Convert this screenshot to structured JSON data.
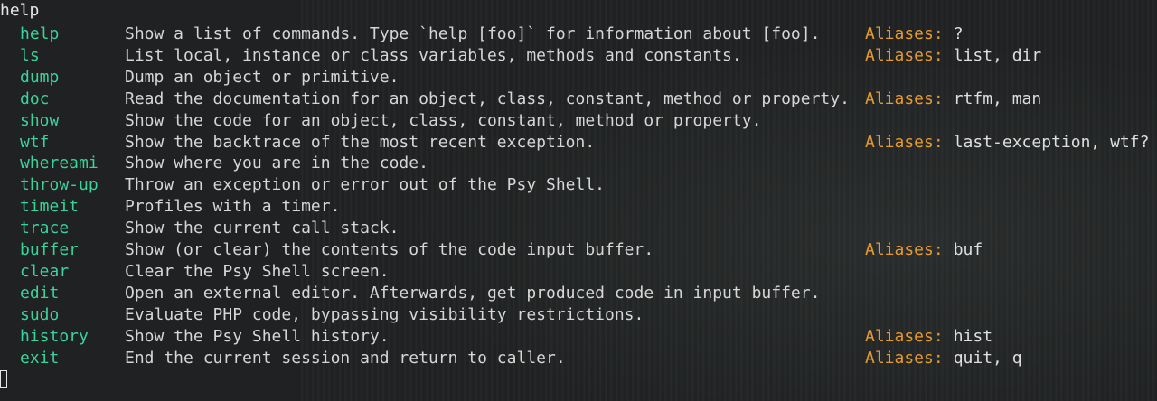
{
  "terminal": {
    "input_command": "help",
    "aliases_label": "Aliases:",
    "commands": [
      {
        "name": "help",
        "description": "Show a list of commands. Type `help [foo]` for information about [foo].",
        "aliases": "?"
      },
      {
        "name": "ls",
        "description": "List local, instance or class variables, methods and constants.",
        "aliases": "list, dir"
      },
      {
        "name": "dump",
        "description": "Dump an object or primitive.",
        "aliases": ""
      },
      {
        "name": "doc",
        "description": "Read the documentation for an object, class, constant, method or property.",
        "aliases": "rtfm, man"
      },
      {
        "name": "show",
        "description": "Show the code for an object, class, constant, method or property.",
        "aliases": ""
      },
      {
        "name": "wtf",
        "description": "Show the backtrace of the most recent exception.",
        "aliases": "last-exception, wtf?"
      },
      {
        "name": "whereami",
        "description": "Show where you are in the code.",
        "aliases": ""
      },
      {
        "name": "throw-up",
        "description": "Throw an exception or error out of the Psy Shell.",
        "aliases": ""
      },
      {
        "name": "timeit",
        "description": "Profiles with a timer.",
        "aliases": ""
      },
      {
        "name": "trace",
        "description": "Show the current call stack.",
        "aliases": ""
      },
      {
        "name": "buffer",
        "description": "Show (or clear) the contents of the code input buffer.",
        "aliases": "buf"
      },
      {
        "name": "clear",
        "description": "Clear the Psy Shell screen.",
        "aliases": ""
      },
      {
        "name": "edit",
        "description": "Open an external editor. Afterwards, get produced code in input buffer.",
        "aliases": ""
      },
      {
        "name": "sudo",
        "description": "Evaluate PHP code, bypassing visibility restrictions.",
        "aliases": ""
      },
      {
        "name": "history",
        "description": "Show the Psy Shell history.",
        "aliases": "hist"
      },
      {
        "name": "exit",
        "description": "End the current session and return to caller.",
        "aliases": "quit, q"
      }
    ]
  },
  "colors": {
    "background": "#1f2122",
    "command_name": "#39d49a",
    "aliases_label": "#e69a2e",
    "text": "#d6d6d6"
  }
}
